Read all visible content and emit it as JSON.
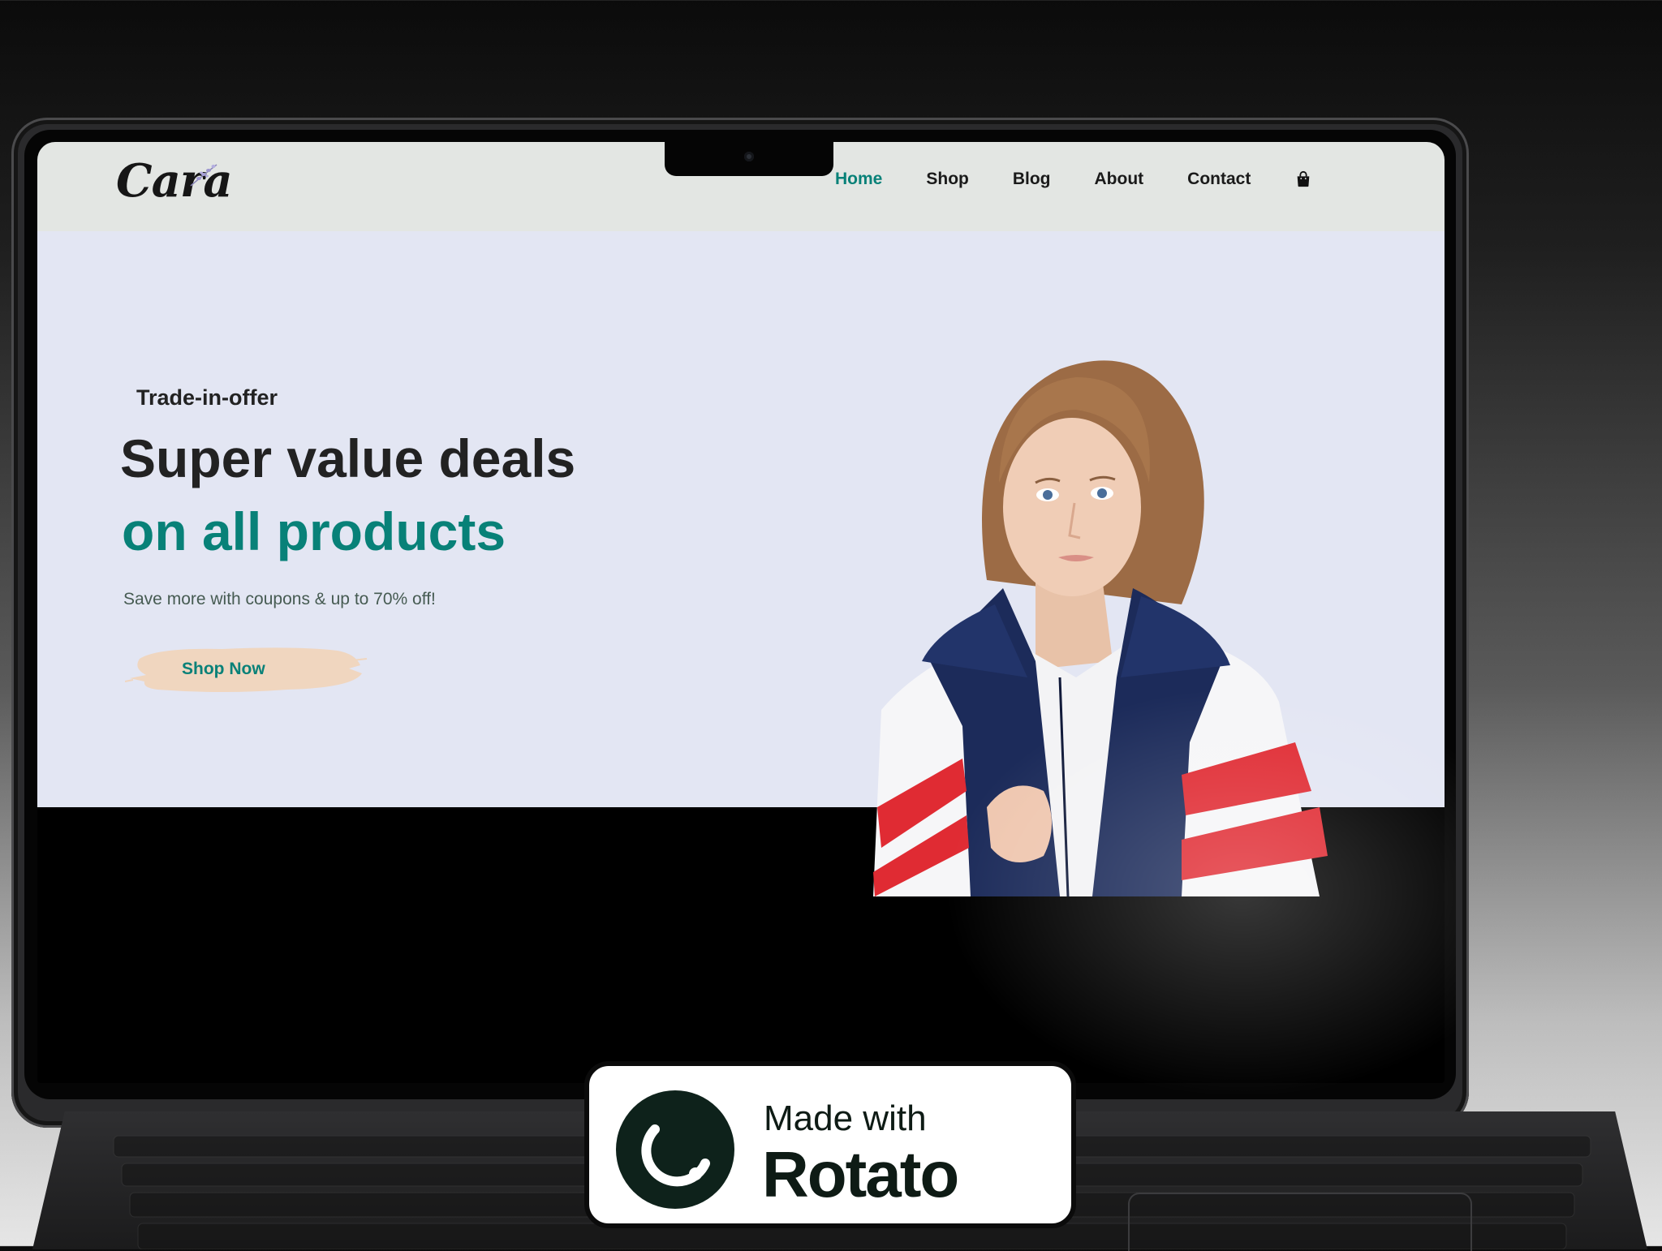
{
  "site": {
    "logo": "Cara",
    "nav": [
      {
        "label": "Home",
        "active": true
      },
      {
        "label": "Shop",
        "active": false
      },
      {
        "label": "Blog",
        "active": false
      },
      {
        "label": "About",
        "active": false
      },
      {
        "label": "Contact",
        "active": false
      }
    ],
    "cart_icon": "shopping-bag-icon"
  },
  "hero": {
    "eyebrow": "Trade-in-offer",
    "headline_line1": "Super value deals",
    "headline_line2": "on all products",
    "subtext": "Save more with coupons & up to 70% off!",
    "cta_label": "Shop Now"
  },
  "badge": {
    "line1": "Made with",
    "line2": "Rotato"
  },
  "colors": {
    "accent": "#088178",
    "hero_bg": "#e3e6f3",
    "header_bg": "#e3e6e3",
    "cta_brush": "#f0d6bf"
  }
}
